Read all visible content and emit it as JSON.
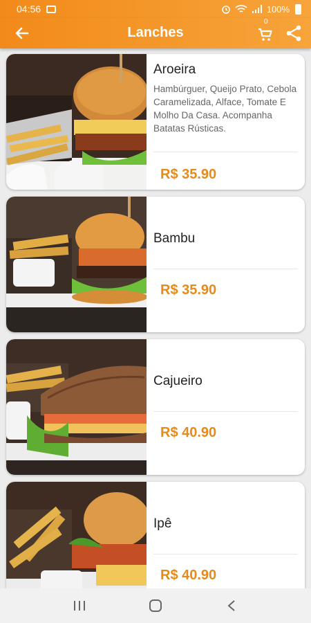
{
  "status_bar": {
    "time": "04:56",
    "battery": "100%",
    "icons": [
      "gallery-icon",
      "alarm-icon",
      "wifi-icon",
      "signal-icon",
      "battery-icon"
    ]
  },
  "app_bar": {
    "title": "Lanches",
    "cart_count": "0",
    "icons": [
      "back-arrow-icon",
      "cart-icon",
      "share-icon"
    ]
  },
  "products": [
    {
      "name": "Aroeira",
      "description": "Hambúrguer, Queijo Prato, Cebola Caramelizada, Alface, Tomate E Molho Da Casa. Acompanha Batatas Rústicas.",
      "price": "R$ 35.90"
    },
    {
      "name": "Bambu",
      "description": "",
      "price": "R$ 35.90"
    },
    {
      "name": "Cajueiro",
      "description": "",
      "price": "R$ 40.90"
    },
    {
      "name": "Ipê",
      "description": "",
      "price": "R$ 40.90"
    }
  ],
  "nav_bar": {
    "icons": [
      "recent-apps-icon",
      "home-icon",
      "back-icon"
    ]
  },
  "colors": {
    "accent": "#f7941d",
    "price": "#e68a1c",
    "background": "#ececec"
  }
}
